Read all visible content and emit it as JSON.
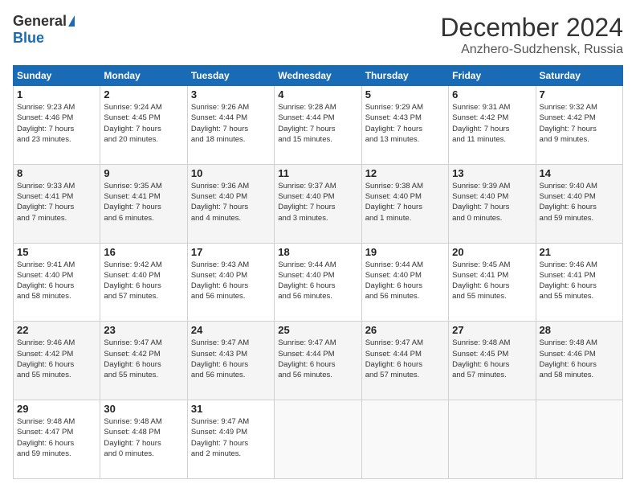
{
  "header": {
    "logo_general": "General",
    "logo_blue": "Blue",
    "month_title": "December 2024",
    "location": "Anzhero-Sudzhensk, Russia"
  },
  "days_of_week": [
    "Sunday",
    "Monday",
    "Tuesday",
    "Wednesday",
    "Thursday",
    "Friday",
    "Saturday"
  ],
  "weeks": [
    [
      {
        "day": 1,
        "sunrise": "9:23 AM",
        "sunset": "4:46 PM",
        "daylight": "7 hours and 23 minutes."
      },
      {
        "day": 2,
        "sunrise": "9:24 AM",
        "sunset": "4:45 PM",
        "daylight": "7 hours and 20 minutes."
      },
      {
        "day": 3,
        "sunrise": "9:26 AM",
        "sunset": "4:44 PM",
        "daylight": "7 hours and 18 minutes."
      },
      {
        "day": 4,
        "sunrise": "9:28 AM",
        "sunset": "4:44 PM",
        "daylight": "7 hours and 15 minutes."
      },
      {
        "day": 5,
        "sunrise": "9:29 AM",
        "sunset": "4:43 PM",
        "daylight": "7 hours and 13 minutes."
      },
      {
        "day": 6,
        "sunrise": "9:31 AM",
        "sunset": "4:42 PM",
        "daylight": "7 hours and 11 minutes."
      },
      {
        "day": 7,
        "sunrise": "9:32 AM",
        "sunset": "4:42 PM",
        "daylight": "7 hours and 9 minutes."
      }
    ],
    [
      {
        "day": 8,
        "sunrise": "9:33 AM",
        "sunset": "4:41 PM",
        "daylight": "7 hours and 7 minutes."
      },
      {
        "day": 9,
        "sunrise": "9:35 AM",
        "sunset": "4:41 PM",
        "daylight": "7 hours and 6 minutes."
      },
      {
        "day": 10,
        "sunrise": "9:36 AM",
        "sunset": "4:40 PM",
        "daylight": "7 hours and 4 minutes."
      },
      {
        "day": 11,
        "sunrise": "9:37 AM",
        "sunset": "4:40 PM",
        "daylight": "7 hours and 3 minutes."
      },
      {
        "day": 12,
        "sunrise": "9:38 AM",
        "sunset": "4:40 PM",
        "daylight": "7 hours and 1 minute."
      },
      {
        "day": 13,
        "sunrise": "9:39 AM",
        "sunset": "4:40 PM",
        "daylight": "7 hours and 0 minutes."
      },
      {
        "day": 14,
        "sunrise": "9:40 AM",
        "sunset": "4:40 PM",
        "daylight": "6 hours and 59 minutes."
      }
    ],
    [
      {
        "day": 15,
        "sunrise": "9:41 AM",
        "sunset": "4:40 PM",
        "daylight": "6 hours and 58 minutes."
      },
      {
        "day": 16,
        "sunrise": "9:42 AM",
        "sunset": "4:40 PM",
        "daylight": "6 hours and 57 minutes."
      },
      {
        "day": 17,
        "sunrise": "9:43 AM",
        "sunset": "4:40 PM",
        "daylight": "6 hours and 56 minutes."
      },
      {
        "day": 18,
        "sunrise": "9:44 AM",
        "sunset": "4:40 PM",
        "daylight": "6 hours and 56 minutes."
      },
      {
        "day": 19,
        "sunrise": "9:44 AM",
        "sunset": "4:40 PM",
        "daylight": "6 hours and 56 minutes."
      },
      {
        "day": 20,
        "sunrise": "9:45 AM",
        "sunset": "4:41 PM",
        "daylight": "6 hours and 55 minutes."
      },
      {
        "day": 21,
        "sunrise": "9:46 AM",
        "sunset": "4:41 PM",
        "daylight": "6 hours and 55 minutes."
      }
    ],
    [
      {
        "day": 22,
        "sunrise": "9:46 AM",
        "sunset": "4:42 PM",
        "daylight": "6 hours and 55 minutes."
      },
      {
        "day": 23,
        "sunrise": "9:47 AM",
        "sunset": "4:42 PM",
        "daylight": "6 hours and 55 minutes."
      },
      {
        "day": 24,
        "sunrise": "9:47 AM",
        "sunset": "4:43 PM",
        "daylight": "6 hours and 56 minutes."
      },
      {
        "day": 25,
        "sunrise": "9:47 AM",
        "sunset": "4:44 PM",
        "daylight": "6 hours and 56 minutes."
      },
      {
        "day": 26,
        "sunrise": "9:47 AM",
        "sunset": "4:44 PM",
        "daylight": "6 hours and 57 minutes."
      },
      {
        "day": 27,
        "sunrise": "9:48 AM",
        "sunset": "4:45 PM",
        "daylight": "6 hours and 57 minutes."
      },
      {
        "day": 28,
        "sunrise": "9:48 AM",
        "sunset": "4:46 PM",
        "daylight": "6 hours and 58 minutes."
      }
    ],
    [
      {
        "day": 29,
        "sunrise": "9:48 AM",
        "sunset": "4:47 PM",
        "daylight": "6 hours and 59 minutes."
      },
      {
        "day": 30,
        "sunrise": "9:48 AM",
        "sunset": "4:48 PM",
        "daylight": "7 hours and 0 minutes."
      },
      {
        "day": 31,
        "sunrise": "9:47 AM",
        "sunset": "4:49 PM",
        "daylight": "7 hours and 2 minutes."
      },
      null,
      null,
      null,
      null
    ]
  ],
  "labels": {
    "sunrise": "Sunrise:",
    "sunset": "Sunset:",
    "daylight": "Daylight hours"
  }
}
